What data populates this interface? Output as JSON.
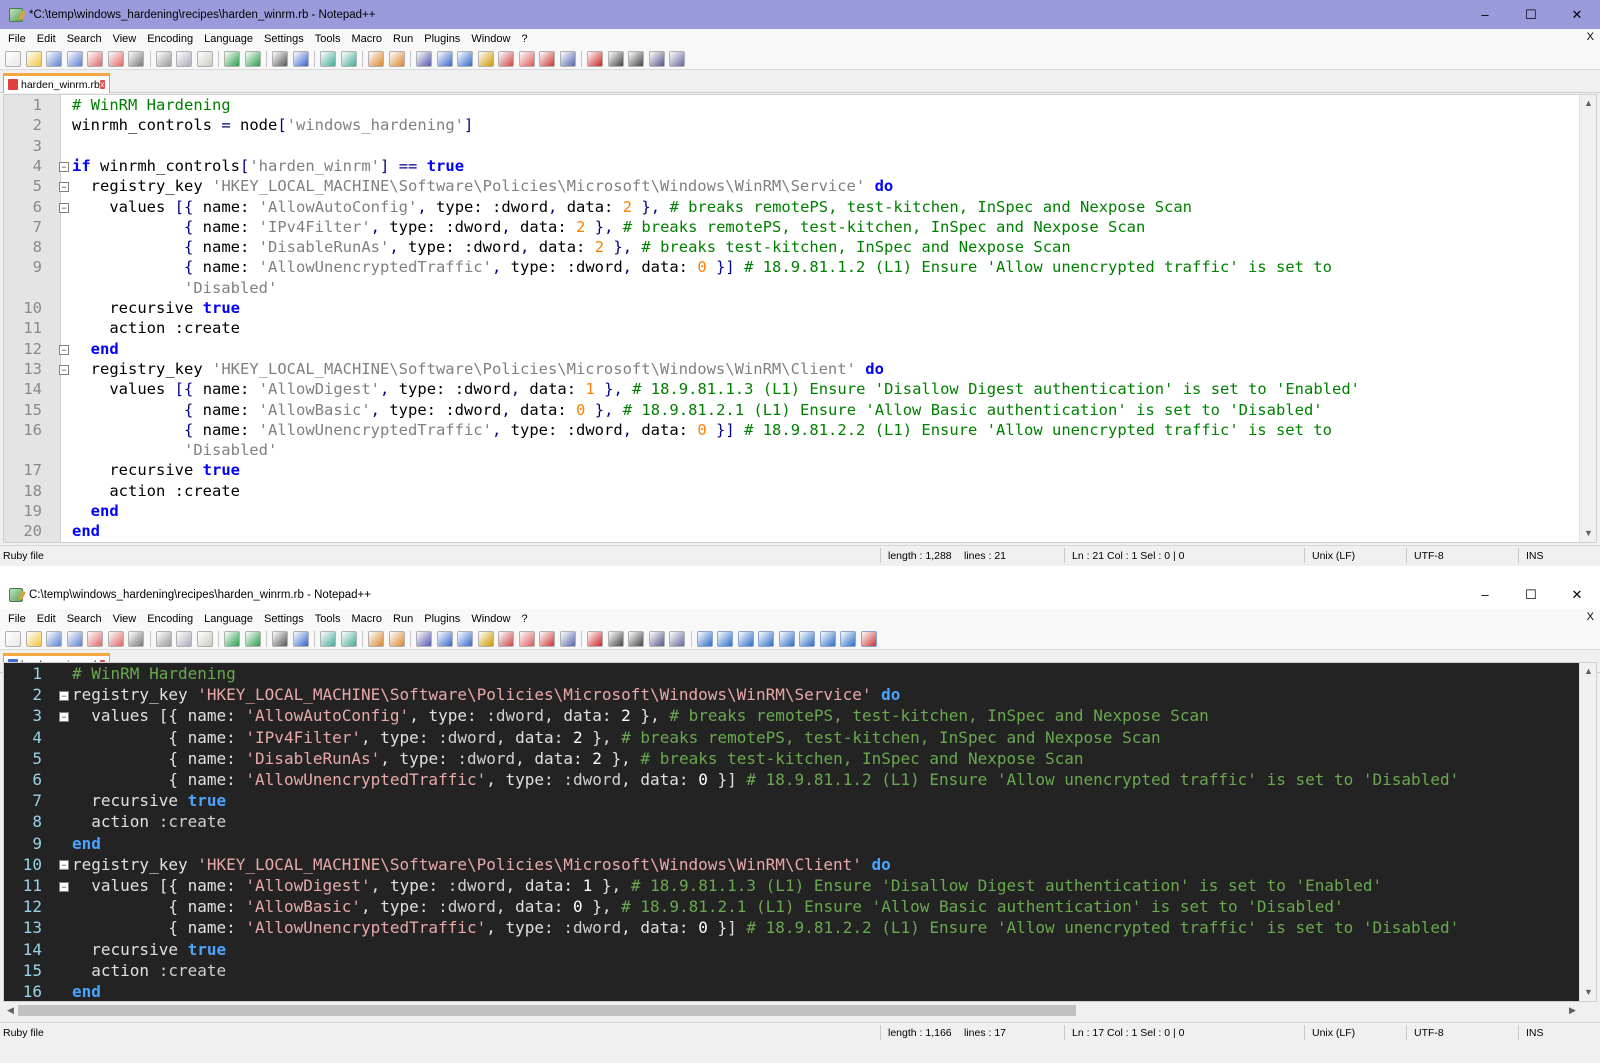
{
  "windows": [
    {
      "title": "*C:\\temp\\windows_hardening\\recipes\\harden_winrm.rb - Notepad++",
      "tab": "harden_winrm.rb",
      "status": {
        "type": "Ruby file",
        "length": "length : 1,288",
        "lines": "lines : 21",
        "pos": "Ln : 21   Col : 1   Sel : 0 | 0",
        "eol": "Unix (LF)",
        "enc": "UTF-8",
        "mode": "INS"
      },
      "lines": [
        {
          "n": "1",
          "t": "# WinRM Hardening"
        },
        {
          "n": "2",
          "t": "winrmh_controls = node['windows_hardening']"
        },
        {
          "n": "3",
          "t": ""
        },
        {
          "n": "4",
          "t": "if winrmh_controls['harden_winrm'] == true"
        },
        {
          "n": "5",
          "t": "  registry_key 'HKEY_LOCAL_MACHINE\\Software\\Policies\\Microsoft\\Windows\\WinRM\\Service' do"
        },
        {
          "n": "6",
          "t": "    values [{ name: 'AllowAutoConfig', type: :dword, data: 2 }, # breaks remotePS, test-kitchen, InSpec and Nexpose Scan"
        },
        {
          "n": "7",
          "t": "            { name: 'IPv4Filter', type: :dword, data: 2 }, # breaks remotePS, test-kitchen, InSpec and Nexpose Scan"
        },
        {
          "n": "8",
          "t": "            { name: 'DisableRunAs', type: :dword, data: 2 }, # breaks test-kitchen, InSpec and Nexpose Scan"
        },
        {
          "n": "9",
          "t": "            { name: 'AllowUnencryptedTraffic', type: :dword, data: 0 }] # 18.9.81.1.2 (L1) Ensure 'Allow unencrypted traffic' is set to"
        },
        {
          "n": "",
          "t": "            'Disabled'"
        },
        {
          "n": "10",
          "t": "    recursive true"
        },
        {
          "n": "11",
          "t": "    action :create"
        },
        {
          "n": "12",
          "t": "  end"
        },
        {
          "n": "13",
          "t": "  registry_key 'HKEY_LOCAL_MACHINE\\Software\\Policies\\Microsoft\\Windows\\WinRM\\Client' do"
        },
        {
          "n": "14",
          "t": "    values [{ name: 'AllowDigest', type: :dword, data: 1 }, # 18.9.81.1.3 (L1) Ensure 'Disallow Digest authentication' is set to 'Enabled'"
        },
        {
          "n": "15",
          "t": "            { name: 'AllowBasic', type: :dword, data: 0 }, # 18.9.81.2.1 (L1) Ensure 'Allow Basic authentication' is set to 'Disabled'"
        },
        {
          "n": "16",
          "t": "            { name: 'AllowUnencryptedTraffic', type: :dword, data: 0 }] # 18.9.81.2.2 (L1) Ensure 'Allow unencrypted traffic' is set to"
        },
        {
          "n": "",
          "t": "            'Disabled'"
        },
        {
          "n": "17",
          "t": "    recursive true"
        },
        {
          "n": "18",
          "t": "    action :create"
        },
        {
          "n": "19",
          "t": "  end"
        },
        {
          "n": "20",
          "t": "end"
        }
      ]
    },
    {
      "title": "C:\\temp\\windows_hardening\\recipes\\harden_winrm.rb - Notepad++",
      "tab": "harden_winrm.rb",
      "status": {
        "type": "Ruby file",
        "length": "length : 1,166",
        "lines": "lines : 17",
        "pos": "Ln : 17   Col : 1   Sel : 0 | 0",
        "eol": "Unix (LF)",
        "enc": "UTF-8",
        "mode": "INS"
      },
      "lines": [
        {
          "n": "1",
          "t": "# WinRM Hardening"
        },
        {
          "n": "2",
          "t": "registry_key 'HKEY_LOCAL_MACHINE\\Software\\Policies\\Microsoft\\Windows\\WinRM\\Service' do"
        },
        {
          "n": "3",
          "t": "  values [{ name: 'AllowAutoConfig', type: :dword, data: 2 }, # breaks remotePS, test-kitchen, InSpec and Nexpose Scan"
        },
        {
          "n": "4",
          "t": "          { name: 'IPv4Filter', type: :dword, data: 2 }, # breaks remotePS, test-kitchen, InSpec and Nexpose Scan"
        },
        {
          "n": "5",
          "t": "          { name: 'DisableRunAs', type: :dword, data: 2 }, # breaks test-kitchen, InSpec and Nexpose Scan"
        },
        {
          "n": "6",
          "t": "          { name: 'AllowUnencryptedTraffic', type: :dword, data: 0 }] # 18.9.81.1.2 (L1) Ensure 'Allow unencrypted traffic' is set to 'Disabled'"
        },
        {
          "n": "7",
          "t": "  recursive true"
        },
        {
          "n": "8",
          "t": "  action :create"
        },
        {
          "n": "9",
          "t": "end"
        },
        {
          "n": "10",
          "t": "registry_key 'HKEY_LOCAL_MACHINE\\Software\\Policies\\Microsoft\\Windows\\WinRM\\Client' do"
        },
        {
          "n": "11",
          "t": "  values [{ name: 'AllowDigest', type: :dword, data: 1 }, # 18.9.81.1.3 (L1) Ensure 'Disallow Digest authentication' is set to 'Enabled'"
        },
        {
          "n": "12",
          "t": "          { name: 'AllowBasic', type: :dword, data: 0 }, # 18.9.81.2.1 (L1) Ensure 'Allow Basic authentication' is set to 'Disabled'"
        },
        {
          "n": "13",
          "t": "          { name: 'AllowUnencryptedTraffic', type: :dword, data: 0 }] # 18.9.81.2.2 (L1) Ensure 'Allow unencrypted traffic' is set to 'Disabled'"
        },
        {
          "n": "14",
          "t": "  recursive true"
        },
        {
          "n": "15",
          "t": "  action :create"
        },
        {
          "n": "16",
          "t": "end"
        }
      ]
    }
  ],
  "menu": [
    "File",
    "Edit",
    "Search",
    "View",
    "Encoding",
    "Language",
    "Settings",
    "Tools",
    "Macro",
    "Run",
    "Plugins",
    "Window",
    "?"
  ],
  "menu_close": "X",
  "window_buttons": {
    "minimize": "–",
    "maximize": "☐",
    "close": "✕"
  },
  "tab_close": "x",
  "fold_glyph": "−",
  "scroll": {
    "up": "▲",
    "down": "▼",
    "left": "◀",
    "right": "▶"
  },
  "colors": {
    "title_active": "#9b9bdc",
    "tab_accent": "#f5a742",
    "light": {
      "comment": "#008000",
      "string": "#808080",
      "keyword": "#0000ff",
      "number": "#ff8000",
      "symbol": "#000000",
      "op": "#000080",
      "text": "#000000"
    },
    "dark": {
      "comment": "#6aa84f",
      "string": "#e8a8a8",
      "keyword": "#4aa3ff",
      "number": "#ffffff",
      "symbol": "#cfcfcf",
      "op": "#e0e0e0",
      "text": "#e0e0e0"
    }
  },
  "toolbar_icons": [
    "new-icon",
    "open-icon",
    "save-icon",
    "save-all-icon",
    "close-icon",
    "close-all-icon",
    "print-icon",
    "cut-icon",
    "copy-icon",
    "paste-icon",
    "undo-icon",
    "redo-icon",
    "find-icon",
    "replace-icon",
    "zoom-in-icon",
    "zoom-out-icon",
    "sync-vertical-icon",
    "sync-horizontal-icon",
    "word-wrap-icon",
    "show-all-chars-icon",
    "indent-guide-icon",
    "user-lang-icon",
    "doc-map-icon",
    "function-list-icon",
    "folder-workspace-icon",
    "monitoring-icon",
    "record-macro-icon",
    "stop-macro-icon",
    "play-macro-icon",
    "run-macro-multiple-icon",
    "save-macro-icon"
  ],
  "toolbar_icons_extra": [
    "compare-icon",
    "compare-clear-icon",
    "compare-nav-icon",
    "first-diff-icon",
    "prev-diff-icon",
    "next-diff-icon",
    "last-diff-icon",
    "diff-options-icon",
    "spellcheck-icon"
  ]
}
